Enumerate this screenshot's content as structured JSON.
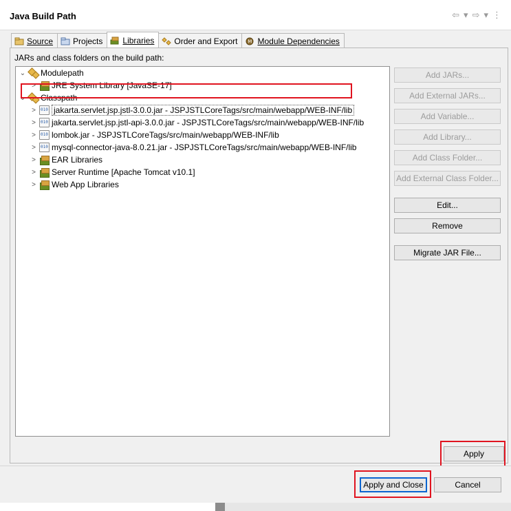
{
  "window": {
    "title": "Java Build Path"
  },
  "nav": {
    "back": "⇦",
    "back_menu": "▾",
    "forward": "⇨",
    "forward_menu": "▾",
    "more": "⋮"
  },
  "tabs": [
    {
      "label": "Source",
      "active": false
    },
    {
      "label": "Projects",
      "active": false
    },
    {
      "label": "Libraries",
      "active": true
    },
    {
      "label": "Order and Export",
      "active": false
    },
    {
      "label": "Module Dependencies",
      "active": false
    }
  ],
  "panel": {
    "label": "JARs and class folders on the build path:"
  },
  "tree": {
    "modulepath": {
      "label": "Modulepath",
      "children": [
        "JRE System Library [JavaSE-17]"
      ]
    },
    "classpath": {
      "label": "Classpath",
      "children": [
        "jakarta.servlet.jsp.jstl-3.0.0.jar - JSPJSTLCoreTags/src/main/webapp/WEB-INF/lib",
        "jakarta.servlet.jsp.jstl-api-3.0.0.jar - JSPJSTLCoreTags/src/main/webapp/WEB-INF/lib",
        "lombok.jar - JSPJSTLCoreTags/src/main/webapp/WEB-INF/lib",
        "mysql-connector-java-8.0.21.jar - JSPJSTLCoreTags/src/main/webapp/WEB-INF/lib",
        "EAR Libraries",
        "Server Runtime [Apache Tomcat v10.1]",
        "Web App Libraries"
      ]
    }
  },
  "buttons": {
    "add_jars": "Add JARs...",
    "add_external_jars": "Add External JARs...",
    "add_variable": "Add Variable...",
    "add_library": "Add Library...",
    "add_class_folder": "Add Class Folder...",
    "add_external_class_folder": "Add External Class Folder...",
    "edit": "Edit...",
    "remove": "Remove",
    "migrate": "Migrate JAR File..."
  },
  "footer": {
    "apply": "Apply",
    "apply_and_close": "Apply and Close",
    "cancel": "Cancel"
  },
  "colors": {
    "highlight": "#e0131f",
    "focus": "#0a64d0"
  }
}
